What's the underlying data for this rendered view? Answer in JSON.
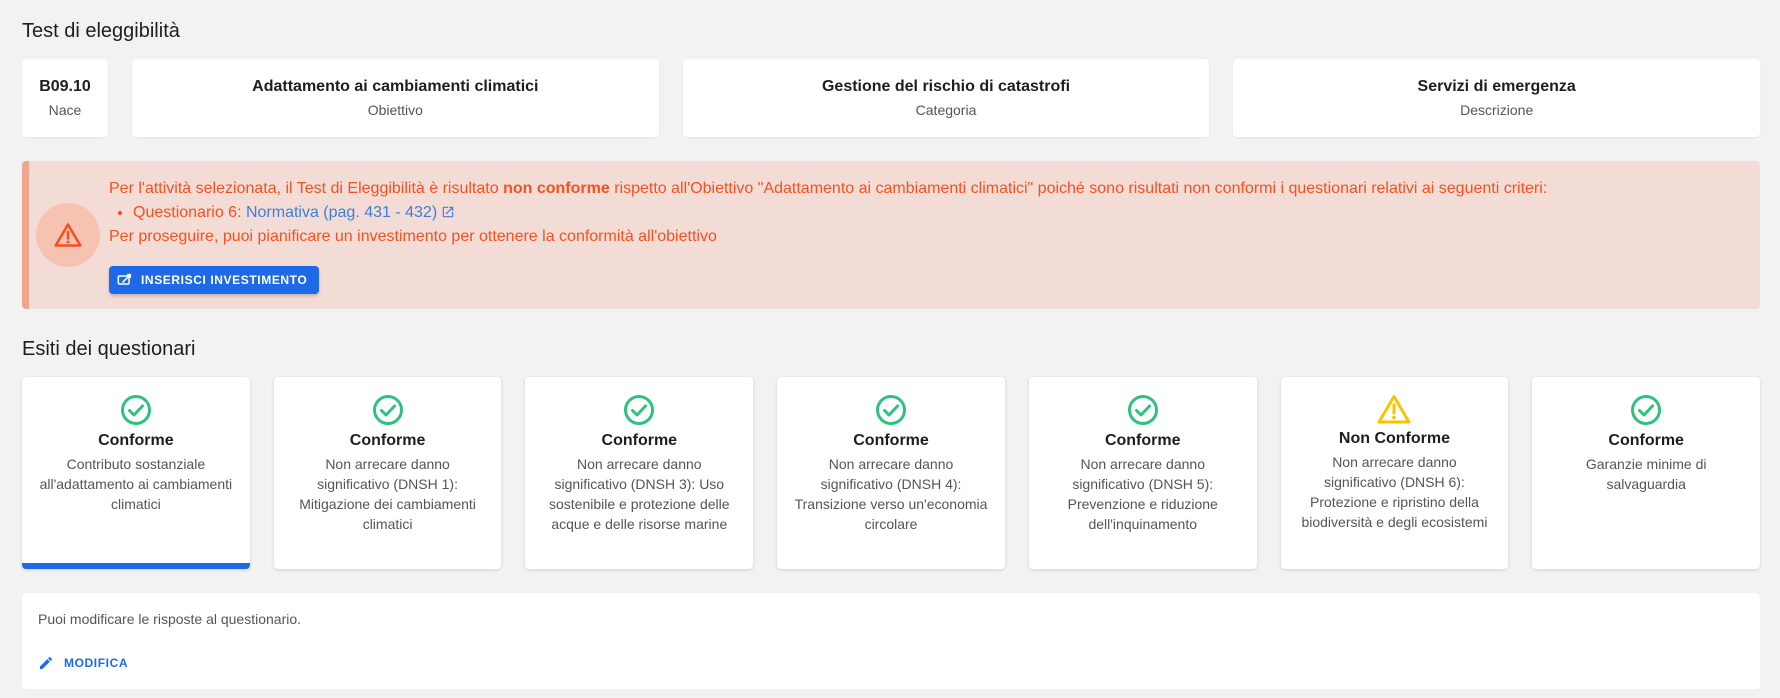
{
  "header": {
    "title": "Test di eleggibilità"
  },
  "info": [
    {
      "value": "B09.10",
      "label": "Nace"
    },
    {
      "value": "Adattamento ai cambiamenti climatici",
      "label": "Obiettivo"
    },
    {
      "value": "Gestione del rischio di catastrofi",
      "label": "Categoria"
    },
    {
      "value": "Servizi di emergenza",
      "label": "Descrizione"
    }
  ],
  "alert": {
    "text_before": "Per l'attività selezionata, il Test di Eleggibilità è risultato ",
    "text_bold": "non conforme",
    "text_after": " rispetto all'Obiettivo \"Adattamento ai cambiamenti climatici\" poiché sono risultati non conformi i questionari relativi ai seguenti criteri:",
    "item_label": "Questionario 6: ",
    "item_link": "Normativa (pag. 431 - 432)",
    "footer": "Per proseguire, puoi pianificare un investimento per ottenere la conformità all'obiettivo",
    "button_label": "INSERISCI INVESTIMENTO",
    "colors": {
      "text": "#f4511e",
      "background": "#f4dcd6",
      "link": "#3d7fd8"
    }
  },
  "results": {
    "title": "Esiti dei questionari",
    "cards": [
      {
        "status": "Conforme",
        "icon": "check-circle-icon",
        "desc": "Contributo sostanziale all'adattamento ai cambiamenti climatici"
      },
      {
        "status": "Conforme",
        "icon": "check-circle-icon",
        "desc": "Non arrecare danno significativo (DNSH 1): Mitigazione dei cambiamenti climatici"
      },
      {
        "status": "Conforme",
        "icon": "check-circle-icon",
        "desc": "Non arrecare danno significativo (DNSH 3): Uso sostenibile e protezione delle acque e delle risorse marine"
      },
      {
        "status": "Conforme",
        "icon": "check-circle-icon",
        "desc": "Non arrecare danno significativo (DNSH 4): Transizione verso un'economia circolare"
      },
      {
        "status": "Conforme",
        "icon": "check-circle-icon",
        "desc": "Non arrecare danno significativo (DNSH 5): Prevenzione e riduzione dell'inquinamento"
      },
      {
        "status": "Non Conforme",
        "icon": "warning-icon",
        "desc": "Non arrecare danno significativo (DNSH 6): Protezione e ripristino della biodiversità e degli ecosistemi"
      },
      {
        "status": "Conforme",
        "icon": "check-circle-icon",
        "desc": "Garanzie minime di salvaguardia"
      }
    ],
    "colors": {
      "ok": "#2ec27e",
      "warning": "#f5c400",
      "accent": "#1e6ae6"
    }
  },
  "edit": {
    "text": "Puoi modificare le risposte al questionario.",
    "button_label": "MODIFICA"
  }
}
